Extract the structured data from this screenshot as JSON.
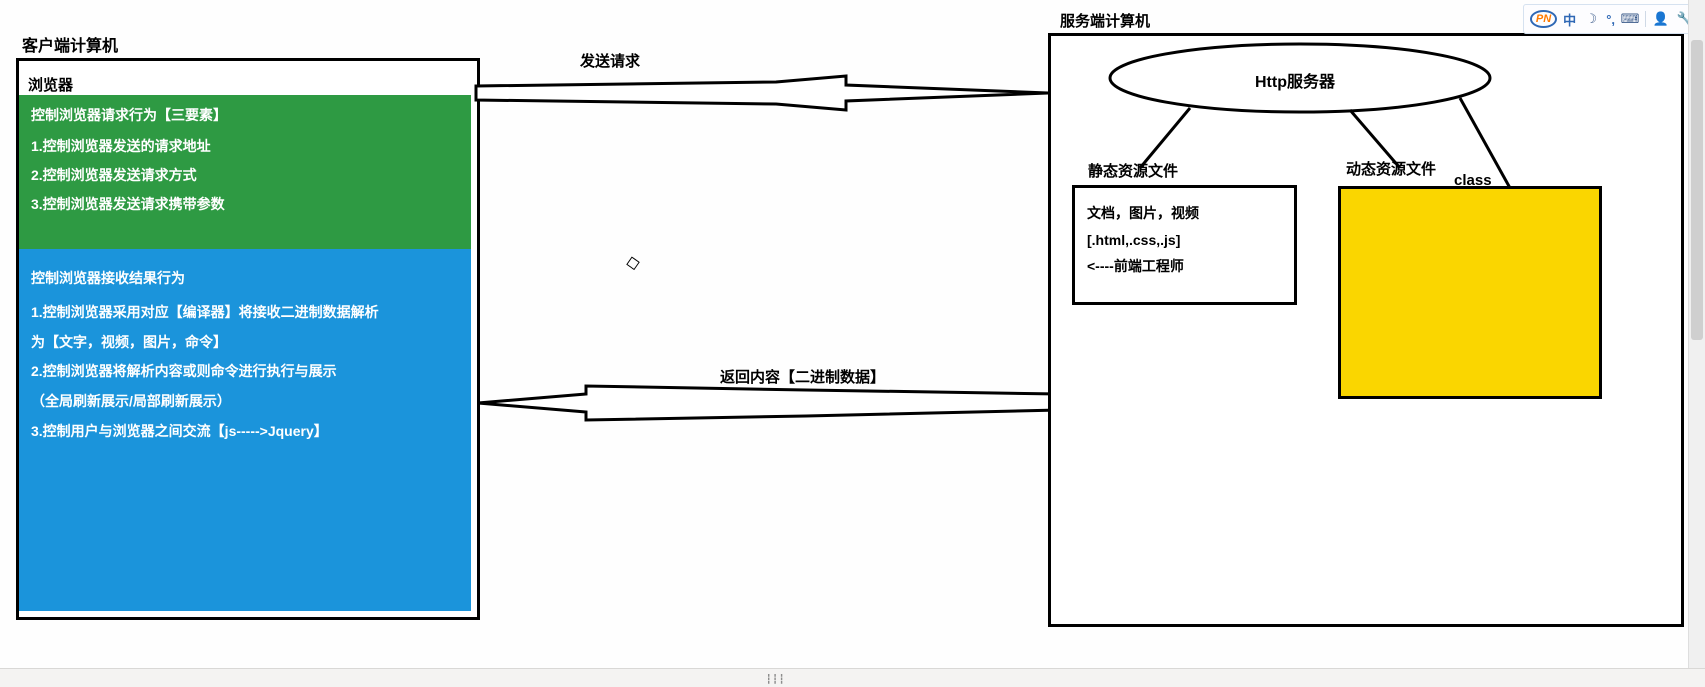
{
  "client": {
    "title": "客户端计算机",
    "browser_label": "浏览器",
    "green": {
      "header": "控制浏览器请求行为【三要素】",
      "lines": [
        "1.控制浏览器发送的请求地址",
        "2.控制浏览器发送请求方式",
        "3.控制浏览器发送请求携带参数"
      ]
    },
    "blue": {
      "header": "控制浏览器接收结果行为",
      "lines": [
        "1.控制浏览器采用对应【编译器】将接收二进制数据解析",
        "为【文字，视频，图片，命令】",
        "2.控制浏览器将解析内容或则命令进行执行与展示",
        "（全局刷新展示/局部刷新展示）",
        "3.控制用户与浏览器之间交流【js----->Jquery】"
      ]
    }
  },
  "arrows": {
    "send_label": "发送请求",
    "return_label": "返回内容【二进制数据】"
  },
  "server": {
    "title": "服务端计算机",
    "http_label": "Http服务器",
    "static": {
      "title": "静态资源文件",
      "lines": [
        "文档，图片，视频",
        "[.html,.css,.js]",
        "<----前端工程师"
      ]
    },
    "dynamic": {
      "title": "动态资源文件",
      "class_label": "class"
    }
  },
  "toolbar": {
    "logo_text": "PN",
    "ime": "中",
    "moon": "☽",
    "degree": "°,",
    "keyboard": "⌨",
    "person": "👤",
    "wrench": "🔧"
  },
  "colors": {
    "green": "#2E9A43",
    "blue": "#1B94DB",
    "yellow": "#FAD600"
  }
}
